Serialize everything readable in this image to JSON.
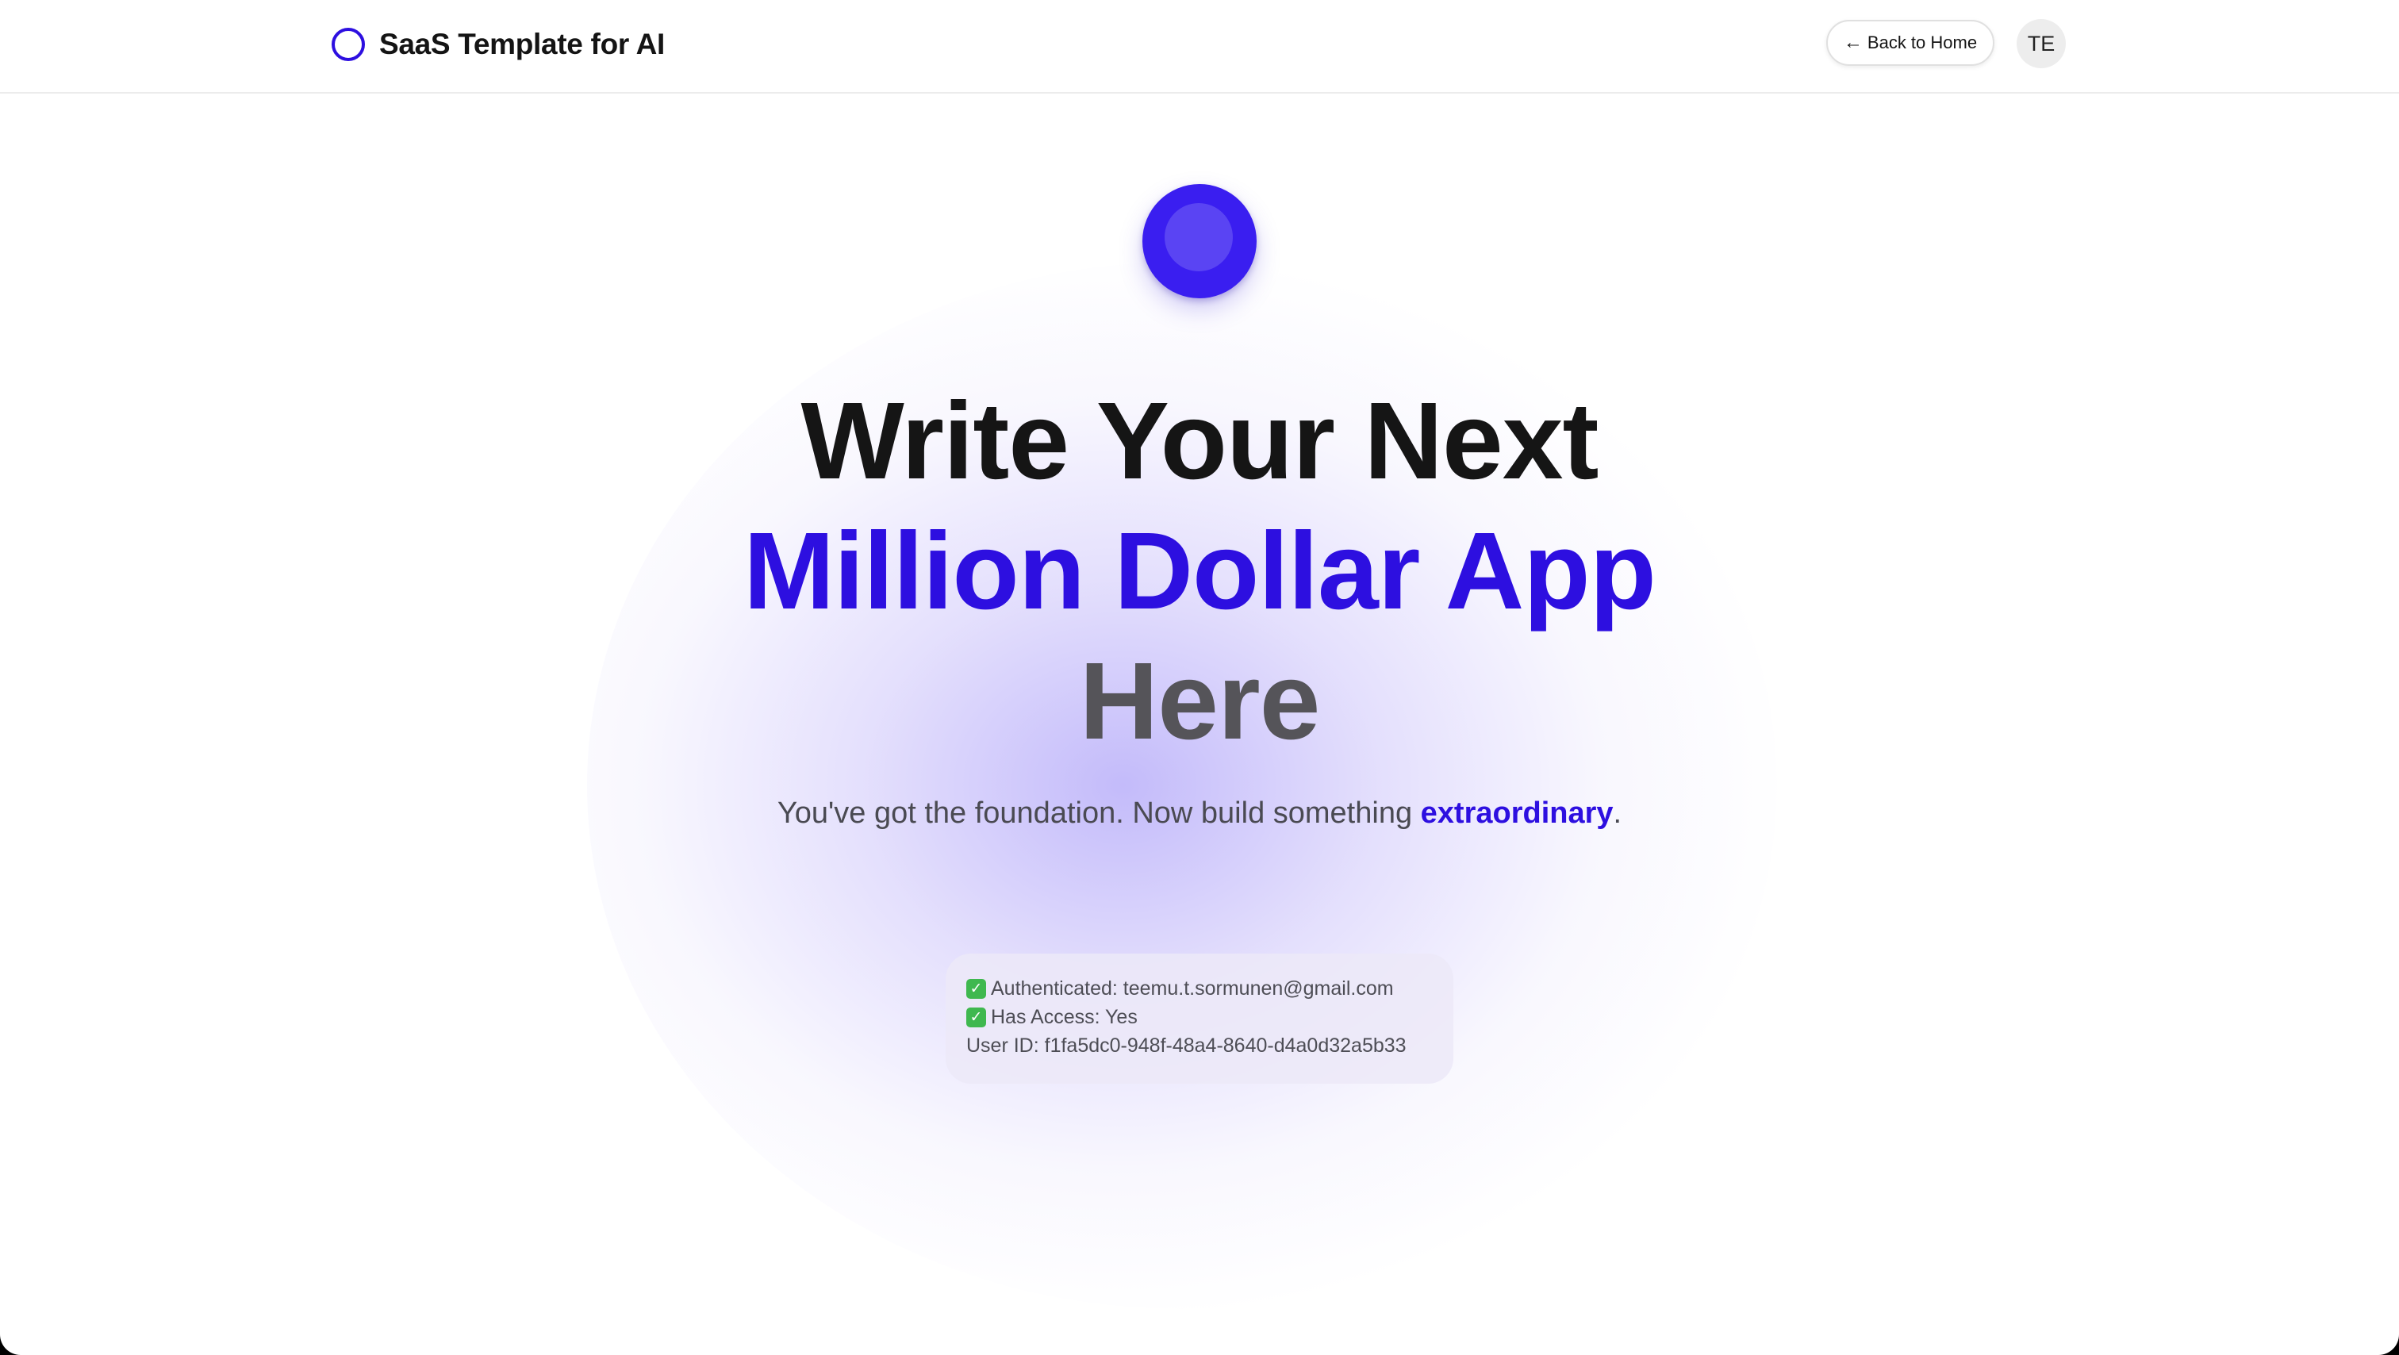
{
  "header": {
    "brand_name": "SaaS Template for AI",
    "back_label": "Back to Home",
    "back_arrow": "←",
    "avatar_initials": "TE"
  },
  "hero": {
    "line1": "Write Your Next",
    "line2": "Million Dollar App",
    "line3": "Here",
    "subtitle_prefix": "You've got the foundation. Now build something ",
    "subtitle_accent": "extraordinary",
    "subtitle_suffix": "."
  },
  "status": {
    "check_glyph": "✓",
    "authenticated": "Authenticated: teemu.t.sormunen@gmail.com",
    "has_access": "Has Access: Yes",
    "user_id": "User ID: f1fa5dc0-948f-48a4-8640-d4a0d32a5b33"
  },
  "colors": {
    "accent": "#2d0fe0",
    "orb": "#3a1ef0",
    "headline_dark": "#151515",
    "headline_gray": "#555459",
    "check_green": "#3fb84f"
  },
  "icons": {
    "brand": "circle-outline-icon",
    "back": "arrow-left-icon",
    "check": "checkmark-box-icon"
  }
}
